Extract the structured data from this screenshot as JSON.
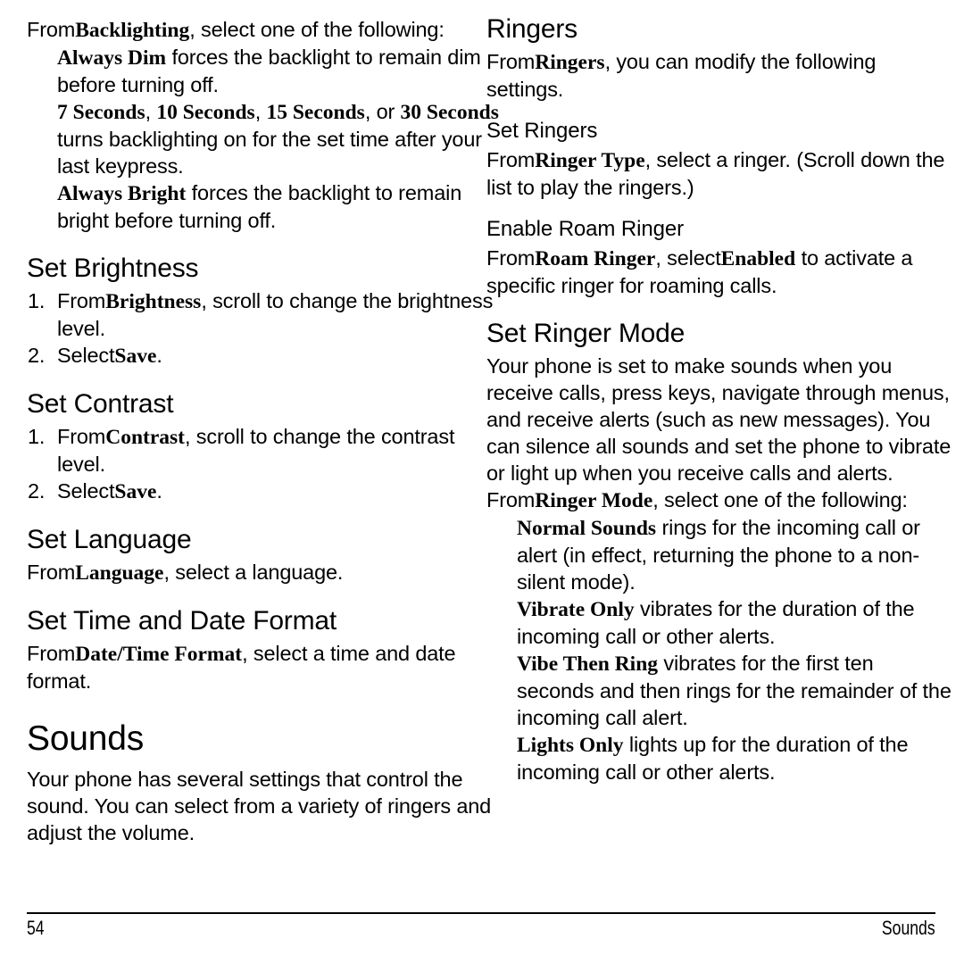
{
  "document": {
    "page_number": "54",
    "footer_title": "Sounds"
  },
  "left_column": {
    "backlighting_intro": "From Backlighting, select one of the following:",
    "backlighting_intro_lead": "From",
    "backlighting_intro_term": "Backlighting",
    "backlighting_intro_rest": ", select one of the following:",
    "backlighting_options": [
      {
        "term": "Always Dim",
        "text": " forces the backlight to remain dim before turning off."
      },
      {
        "term": "7 Seconds",
        "term2": "10 Seconds",
        "term3": "15 Seconds",
        "term4": "30 Seconds",
        "sep1": ", ",
        "sep2": ", ",
        "sep3": ", or ",
        "text": " turns backlighting on for the set time after your last keypress."
      },
      {
        "term": "Always Bright",
        "text": " forces the backlight to remain bright before turning off."
      }
    ],
    "set_brightness": {
      "heading": "Set Brightness",
      "steps": [
        {
          "lead": "From",
          "term": "Brightness",
          "rest": ", scroll to change the brightness level."
        },
        {
          "lead": "Select",
          "term": "Save",
          "rest": "."
        }
      ]
    },
    "set_contrast": {
      "heading": "Set Contrast",
      "steps": [
        {
          "lead": "From",
          "term": "Contrast",
          "rest": ", scroll to change the contrast level."
        },
        {
          "lead": "Select",
          "term": "Save",
          "rest": "."
        }
      ]
    },
    "set_language": {
      "heading": "Set Language",
      "lead": "From",
      "term": "Language",
      "rest": ", select a language."
    },
    "set_time_date_format": {
      "heading": "Set Time and Date Format",
      "lead": "From",
      "term": "Date/Time Format",
      "rest": ", select a time and date format."
    },
    "sounds": {
      "heading": "Sounds",
      "intro": "Your phone has several settings that control the sound. You can select from a variety of ringers and adjust the volume."
    }
  },
  "right_column": {
    "ringers": {
      "heading": "Ringers",
      "lead": "From",
      "term": "Ringers",
      "rest": ", you can modify the following settings."
    },
    "set_ringers": {
      "heading": "Set Ringers",
      "lead": "From",
      "term": "Ringer Type",
      "rest": ", select a ringer. (Scroll down the list to play the ringers.)"
    },
    "enable_roam_ringer": {
      "heading": "Enable Roam Ringer",
      "lead": "From",
      "term": "Roam Ringer",
      "mid": ", select",
      "term2": "Enabled",
      "rest": " to activate a specific ringer for roaming calls."
    },
    "set_ringer_mode": {
      "heading": "Set Ringer Mode",
      "intro": "Your phone is set to make sounds when you receive calls, press keys, navigate through menus, and receive alerts (such as new messages). You can silence all sounds and set the phone to vibrate or light up when you receive calls and alerts.",
      "select_lead": "From",
      "select_term": "Ringer Mode",
      "select_rest": ", select one of the following:",
      "options": [
        {
          "term": "Normal Sounds",
          "text": " rings for the incoming call or alert (in effect, returning the phone to a non-silent mode)."
        },
        {
          "term": "Vibrate Only",
          "text": " vibrates for the duration of the incoming call or other alerts."
        },
        {
          "term": "Vibe Then Ring",
          "text": " vibrates for the first ten seconds and then rings for the remainder of the incoming call alert."
        },
        {
          "term": "Lights Only",
          "text": " lights up for the duration of the incoming call or other alerts."
        }
      ]
    }
  }
}
